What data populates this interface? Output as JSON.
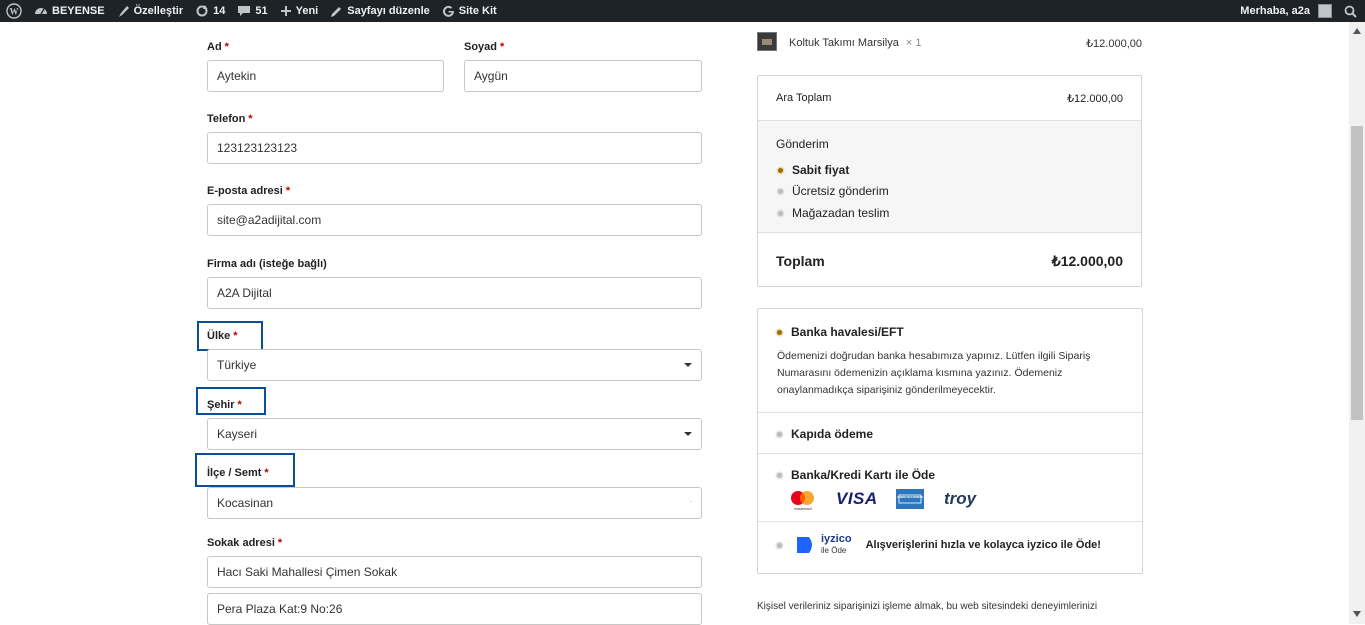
{
  "admin_bar": {
    "site_name": "BEYENSE",
    "customize": "Özelleştir",
    "updates_count": "14",
    "comments_count": "51",
    "new": "Yeni",
    "edit_page": "Sayfayı düzenle",
    "site_kit": "Site Kit",
    "greeting": "Merhaba, a2a"
  },
  "form": {
    "first_name": {
      "label": "Ad",
      "required": "*",
      "value": "Aytekin"
    },
    "last_name": {
      "label": "Soyad",
      "required": "*",
      "value": "Aygün"
    },
    "phone": {
      "label": "Telefon",
      "required": "*",
      "value": "123123123123"
    },
    "email": {
      "label": "E-posta adresi",
      "required": "*",
      "value": "site@a2adijital.com"
    },
    "company": {
      "label": "Firma adı (isteğe bağlı)",
      "value": "A2A Dijital"
    },
    "country": {
      "label": "Ülke",
      "required": "*",
      "value": "Türkiye"
    },
    "city": {
      "label": "Şehir",
      "required": "*",
      "value": "Kayseri"
    },
    "district": {
      "label": "İlçe / Semt",
      "required": "*",
      "value": "Kocasinan"
    },
    "street": {
      "label": "Sokak adresi",
      "required": "*",
      "value1": "Hacı Saki Mahallesi Çimen Sokak",
      "value2": "Pera Plaza Kat:9 No:26"
    }
  },
  "order": {
    "product_name": "Koltuk Takımı Marsilya",
    "product_qty": "× 1",
    "product_price": "₺12.000,00",
    "subtotal_label": "Ara Toplam",
    "subtotal_value": "₺12.000,00",
    "shipping_label": "Gönderim",
    "shipping_options": [
      "Sabit fiyat",
      "Ücretsiz gönderim",
      "Mağazadan teslim"
    ],
    "total_label": "Toplam",
    "total_value": "₺12.000,00"
  },
  "payment": {
    "bank_transfer": "Banka havalesi/EFT",
    "bank_desc": "Ödemenizi doğrudan banka hesabımıza yapınız. Lütfen ilgili Sipariş Numarasını ödemenizin açıklama kısmına yazınız. Ödemeniz onaylanmadıkça siparişiniz gönderilmeyecektir.",
    "cash_on_delivery": "Kapıda ödeme",
    "card": "Banka/Kredi Kartı ile Öde",
    "card_logos": [
      "mastercard",
      "VISA",
      "AMERICAN EXPRESS",
      "troy"
    ],
    "iyzico_brand": "iyzico",
    "iyzico_sub": "ile Öde",
    "iyzico_text": "Alışverişlerini hızla ve kolayca iyzico ile Öde!"
  },
  "privacy_text": "Kişisel verileriniz siparişinizi işleme almak, bu web sitesindeki deneyimlerinizi",
  "colors": {
    "adminbar": "#1d2327",
    "highlight": "#0b4f96",
    "required": "#bb0000",
    "selected_radio": "#9a7000"
  }
}
